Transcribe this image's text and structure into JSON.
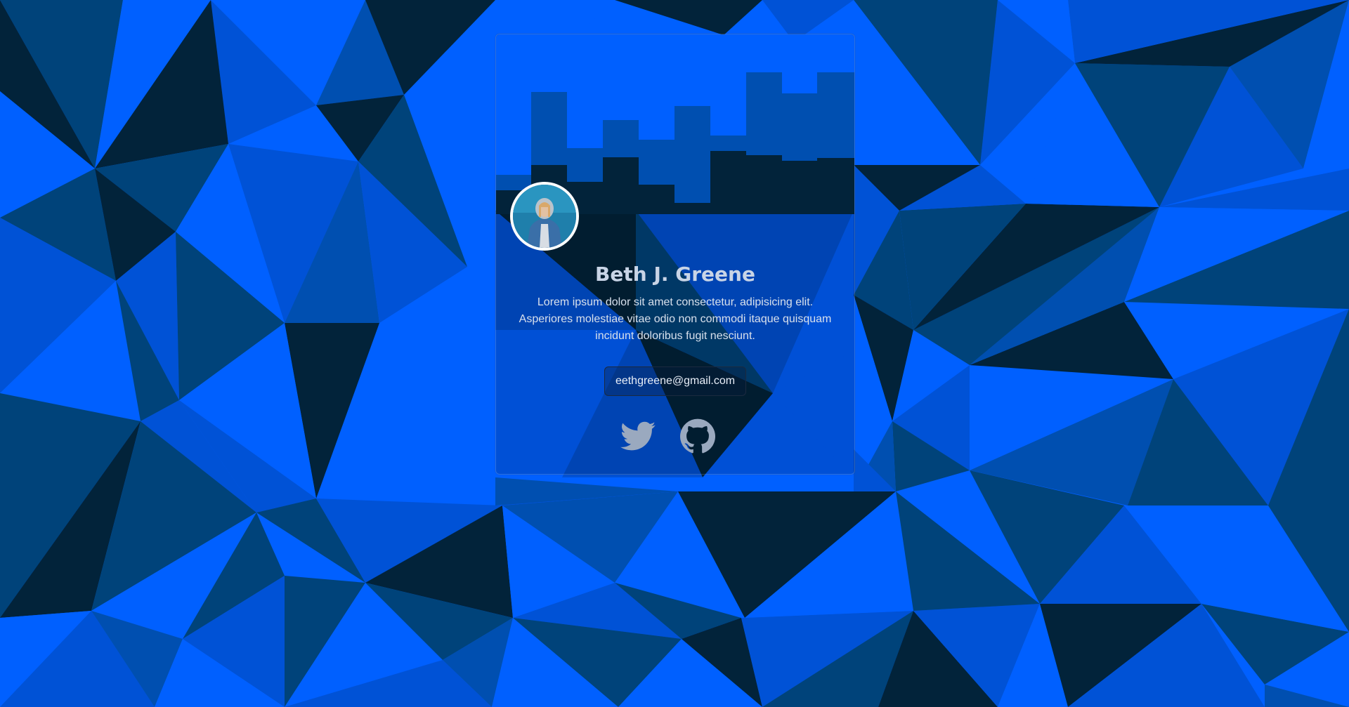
{
  "profile": {
    "name": "Beth J. Greene",
    "bio": "Lorem ipsum dolor sit amet consectetur, adipisicing elit. Asperiores molestiae vitae odio non commodi itaque quisquam incidunt doloribus fugit nesciunt.",
    "email": "eethgreene@gmail.com"
  },
  "social": {
    "twitter_icon": "twitter-icon",
    "github_icon": "github-icon"
  },
  "colors": {
    "background_primary": "#0060ff",
    "background_dark": "#02233a",
    "banner_mid": "#004fb0",
    "text_light": "#c8d4e6",
    "icon_color": "#9aa9bf"
  }
}
